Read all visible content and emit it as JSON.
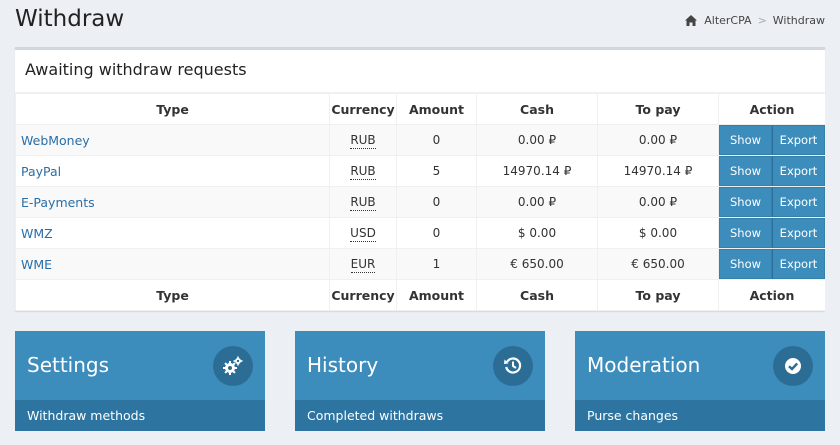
{
  "header": {
    "title": "Withdraw",
    "breadcrumb": {
      "home": "AlterCPA",
      "separator": ">",
      "current": "Withdraw"
    }
  },
  "box": {
    "title": "Awaiting withdraw requests",
    "columns": [
      "Type",
      "Currency",
      "Amount",
      "Cash",
      "To pay",
      "Action"
    ],
    "rows": [
      {
        "type": "WebMoney",
        "currency": "RUB",
        "amount": "0",
        "cash": "0.00 ₽",
        "to_pay": "0.00 ₽"
      },
      {
        "type": "PayPal",
        "currency": "RUB",
        "amount": "5",
        "cash": "14970.14 ₽",
        "to_pay": "14970.14 ₽"
      },
      {
        "type": "E-Payments",
        "currency": "RUB",
        "amount": "0",
        "cash": "0.00 ₽",
        "to_pay": "0.00 ₽"
      },
      {
        "type": "WMZ",
        "currency": "USD",
        "amount": "0",
        "cash": "$ 0.00",
        "to_pay": "$ 0.00"
      },
      {
        "type": "WME",
        "currency": "EUR",
        "amount": "1",
        "cash": "€ 650.00",
        "to_pay": "€ 650.00"
      }
    ],
    "show_label": "Show",
    "export_label": "Export"
  },
  "tiles": [
    {
      "name": "Settings",
      "footer": "Withdraw methods",
      "icon": "gears-icon"
    },
    {
      "name": "History",
      "footer": "Completed withdraws",
      "icon": "history-icon"
    },
    {
      "name": "Moderation",
      "footer": "Purse changes",
      "icon": "check-circle-icon"
    }
  ],
  "colors": {
    "accent": "#3c8dbc",
    "accent_dark": "#2d74a1",
    "link": "#2a6ea7",
    "background": "#ecf0f5"
  }
}
